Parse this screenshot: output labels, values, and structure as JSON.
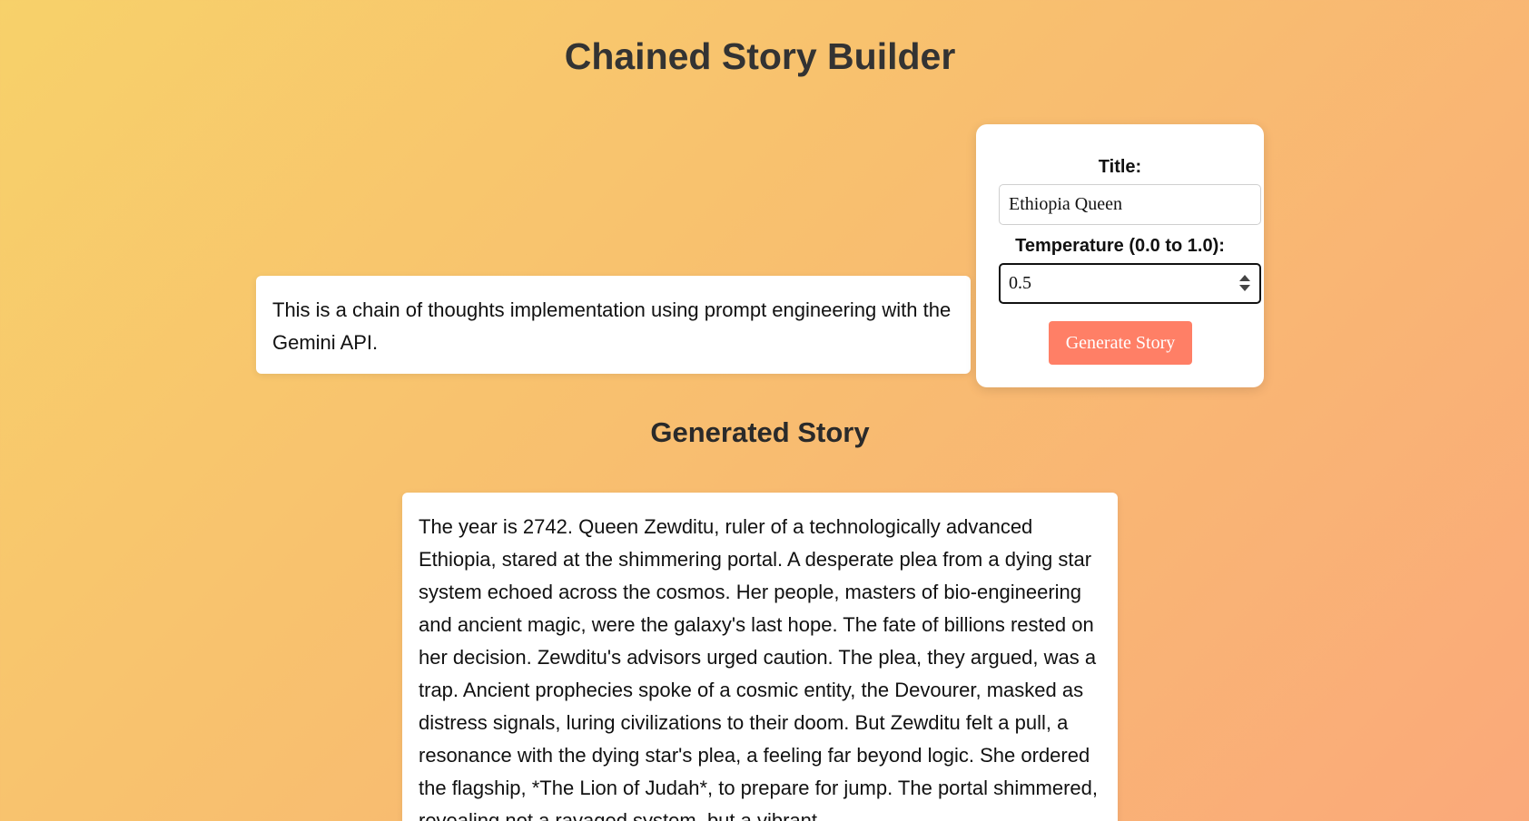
{
  "page": {
    "title": "Chained Story Builder"
  },
  "intro": {
    "text": "This is a chain of thoughts implementation using prompt engineering with the Gemini API."
  },
  "form": {
    "title_label": "Title:",
    "title_value": "Ethiopia Queen",
    "temperature_label": "Temperature (0.0 to 1.0):",
    "temperature_value": "0.5",
    "generate_label": "Generate Story"
  },
  "story": {
    "heading": "Generated Story",
    "text": "The year is 2742. Queen Zewditu, ruler of a technologically advanced Ethiopia, stared at the shimmering portal. A desperate plea from a dying star system echoed across the cosmos. Her people, masters of bio-engineering and ancient magic, were the galaxy's last hope. The fate of billions rested on her decision. Zewditu's advisors urged caution. The plea, they argued, was a trap. Ancient prophecies spoke of a cosmic entity, the Devourer, masked as distress signals, luring civilizations to their doom. But Zewditu felt a pull, a resonance with the dying star's plea, a feeling far beyond logic. She ordered the flagship, *The Lion of Judah*, to prepare for jump. The portal shimmered, revealing not a ravaged system, but a vibrant"
  },
  "colors": {
    "background_start": "#f7d16a",
    "background_end": "#faa97a",
    "button": "#ff7f66",
    "card": "#ffffff",
    "text": "#333333"
  }
}
